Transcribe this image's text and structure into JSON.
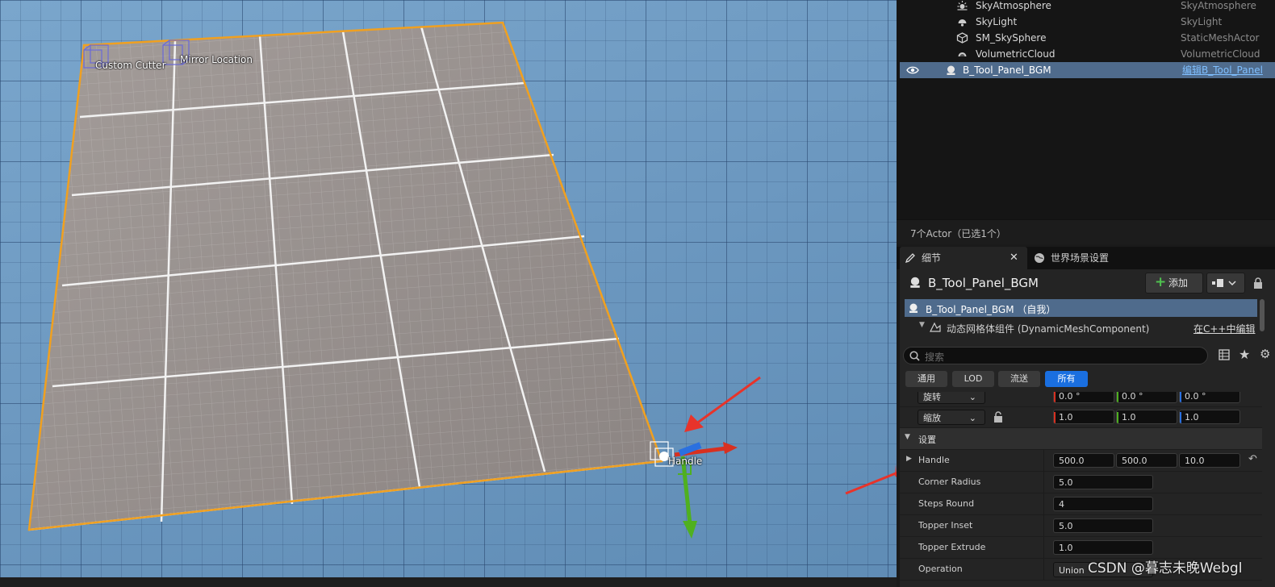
{
  "viewport": {
    "labels": {
      "custom_cutter": "Custom Cutter",
      "mirror_location": "Mirror Location",
      "handle": "Handle"
    }
  },
  "outliner": {
    "items": [
      {
        "name": "SkyAtmosphere",
        "type": "SkyAtmosphere",
        "icon": "sky-atmosphere-icon"
      },
      {
        "name": "SkyLight",
        "type": "SkyLight",
        "icon": "skylight-icon"
      },
      {
        "name": "SM_SkySphere",
        "type": "StaticMeshActor",
        "icon": "static-mesh-icon"
      },
      {
        "name": "VolumetricCloud",
        "type": "VolumetricCloud",
        "icon": "cloud-icon"
      },
      {
        "name": "B_Tool_Panel_BGM",
        "type": "编辑B_Tool_Panel",
        "icon": "blueprint-actor-icon",
        "selected": true
      }
    ],
    "footer": "7个Actor（已选1个）"
  },
  "tabs": {
    "details": "细节",
    "world_settings": "世界场景设置"
  },
  "details": {
    "actor_name": "B_Tool_Panel_BGM",
    "add_label": "添加",
    "components": {
      "root": "B_Tool_Panel_BGM （自我）",
      "child": "动态网格体组件 (DynamicMeshComponent)",
      "child_link": "在C++中编辑"
    },
    "search_placeholder": "搜索",
    "filters": [
      "通用",
      "LOD",
      "流送",
      "所有"
    ],
    "active_filter": "所有",
    "transform": {
      "rotation_label": "旋转",
      "rotation": [
        "0.0 °",
        "0.0 °",
        "0.0 °"
      ],
      "scale_label": "缩放",
      "scale": [
        "1.0",
        "1.0",
        "1.0"
      ]
    },
    "section_title": "设置",
    "properties": {
      "handle_label": "Handle",
      "handle_values": [
        "500.0",
        "500.0",
        "10.0"
      ],
      "corner_radius_label": "Corner Radius",
      "corner_radius": "5.0",
      "steps_round_label": "Steps Round",
      "steps_round": "4",
      "topper_inset_label": "Topper Inset",
      "topper_inset": "5.0",
      "topper_extrude_label": "Topper Extrude",
      "topper_extrude": "1.0",
      "operation_label": "Operation",
      "operation": "Union"
    }
  },
  "watermark": "CSDN @暮志未晚Webgl",
  "colors": {
    "selection": "#4f6b8c",
    "accent_blue": "#1a6fe0",
    "outline_orange": "#f0a020",
    "axis_x": "#d83020",
    "axis_y": "#4fb020",
    "axis_z": "#2a70e0",
    "annotation_arrow": "#e8332a"
  }
}
